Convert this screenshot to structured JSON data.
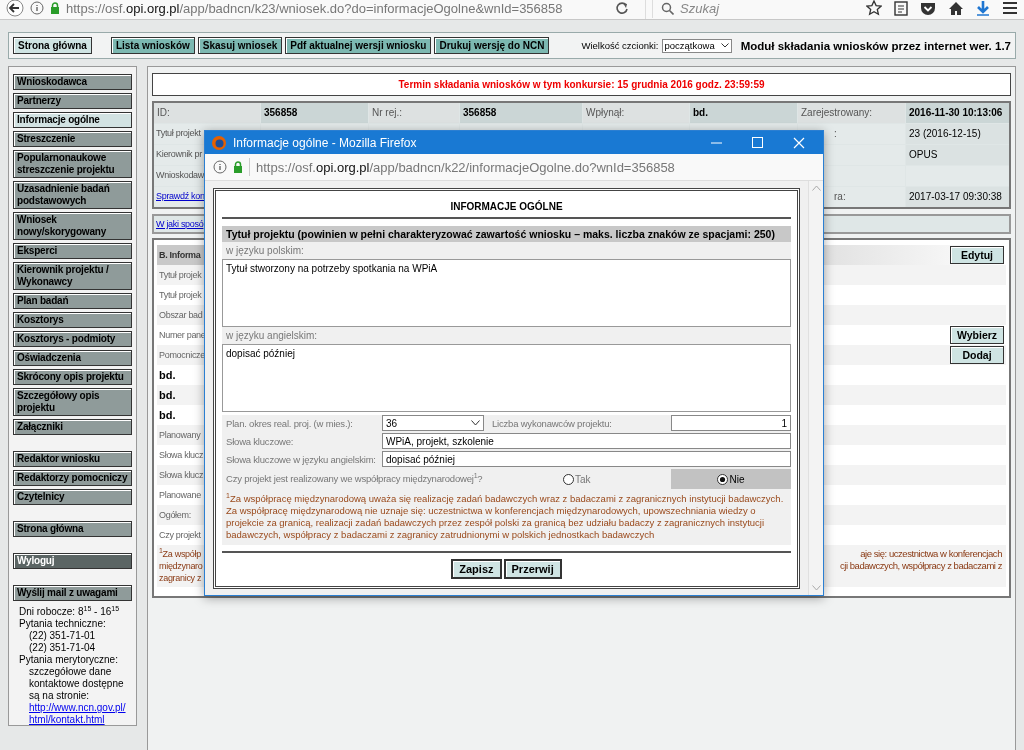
{
  "browser": {
    "url": {
      "prefix": "https://osf.",
      "domain": "opi.org.pl",
      "path": "/app/badncn/k23/wniosek.do?do=informacjeOgolne&wnId=356858"
    },
    "search": {
      "placeholder": "Szukaj"
    }
  },
  "top_nav": {
    "buttons": [
      {
        "label": "Strona główna",
        "kind": "home"
      },
      {
        "label": "Lista wniosków",
        "kind": "action"
      },
      {
        "label": "Skasuj wniosek",
        "kind": "action"
      },
      {
        "label": "Pdf aktualnej wersji wniosku",
        "kind": "action"
      },
      {
        "label": "Drukuj wersję do NCN",
        "kind": "action"
      }
    ],
    "font_size": {
      "label": "Wielkość czcionki:",
      "value": "początkowa"
    },
    "module_title": "Moduł składania wniosków przez internet wer. 1.7"
  },
  "sidebar": {
    "sections": [
      {
        "items": [
          {
            "label": "Wnioskodawca",
            "kind": "nav",
            "selected": false
          },
          {
            "label": "Partnerzy",
            "kind": "nav",
            "selected": false
          },
          {
            "label": "Informacje ogólne",
            "kind": "nav",
            "selected": true
          },
          {
            "label": "Streszczenie",
            "kind": "nav",
            "selected": false
          },
          {
            "label": "Popularnonaukowe streszczenie projektu",
            "kind": "nav",
            "selected": false
          },
          {
            "label": "Uzasadnienie badań podstawowych",
            "kind": "nav",
            "selected": false
          },
          {
            "label": "Wniosek nowy/skorygowany",
            "kind": "nav",
            "selected": false
          },
          {
            "label": "Eksperci",
            "kind": "nav",
            "selected": false
          },
          {
            "label": "Kierownik projektu / Wykonawcy",
            "kind": "nav",
            "selected": false
          },
          {
            "label": "Plan badań",
            "kind": "nav",
            "selected": false
          },
          {
            "label": "Kosztorys",
            "kind": "nav",
            "selected": false
          },
          {
            "label": "Kosztorys - podmioty",
            "kind": "nav",
            "selected": false
          },
          {
            "label": "Oświadczenia",
            "kind": "nav",
            "selected": false
          },
          {
            "label": "Skrócony opis projektu",
            "kind": "nav",
            "selected": false
          },
          {
            "label": "Szczegółowy opis projektu",
            "kind": "nav",
            "selected": false
          },
          {
            "label": "Załączniki",
            "kind": "nav",
            "selected": false
          }
        ]
      },
      {
        "items": [
          {
            "label": "Redaktor wniosku",
            "kind": "nav",
            "selected": false
          },
          {
            "label": "Redaktorzy pomocniczy",
            "kind": "nav",
            "selected": false
          },
          {
            "label": "Czytelnicy",
            "kind": "nav",
            "selected": false
          }
        ]
      },
      {
        "items": [
          {
            "label": "Strona główna",
            "kind": "nav",
            "selected": false
          }
        ]
      },
      {
        "items": [
          {
            "label": "Wyloguj",
            "kind": "logout",
            "selected": false
          }
        ]
      },
      {
        "items": [
          {
            "label": "Wyślij mail z uwagami",
            "kind": "nav",
            "selected": false
          }
        ]
      }
    ],
    "contact": {
      "hours": "Dni robocze: 8$^{15}$ - 16$^{15}$",
      "technical_label": "Pytania techniczne:",
      "phones": [
        "(22) 351-71-01",
        "(22) 351-71-04"
      ],
      "substantive_label": "Pytania merytoryczne:",
      "substantive_text": "szczegółowe dane kontaktowe dostępne są na stronie:",
      "link": "http://www.ncn.gov.pl/html/kontakt.html"
    }
  },
  "deadline": "Termin składania wniosków w tym konkursie: 15 grudnia 2016 godz. 23:59:59",
  "info_table": {
    "header_cells": [
      "ID:",
      "356858",
      "Nr rej.:",
      "356858",
      "Wpłynął:",
      "bd.",
      "Zarejestrowany:",
      "2016-11-30 10:13:06"
    ],
    "rows": [
      {
        "label": "Tytuł projekt",
        "kind": "label",
        "right_label": ":",
        "right_value": "23 (2016-12-15)"
      },
      {
        "label": "Kierownik pr",
        "kind": "label",
        "right_value": "OPUS"
      },
      {
        "label": "Wnioskodaw",
        "kind": "label"
      },
      {
        "label": "Sprawdź kon",
        "kind": "link",
        "right_label": "ra:",
        "right_value": "2017-03-17 09:30:38"
      }
    ]
  },
  "help_link": "W jaki sposó",
  "section_b": {
    "title": "B. Informa",
    "edit_button": "Edytuj",
    "rows": [
      {
        "label": "Tytuł projek",
        "kind": "label"
      },
      {
        "label": "Tytuł projek",
        "kind": "label"
      },
      {
        "label": "Obszar bad",
        "kind": "label"
      },
      {
        "label": "Numer pane",
        "kind": "label",
        "button": "Wybierz"
      },
      {
        "label": "Pomocnicze",
        "kind": "label",
        "button": "Dodaj"
      },
      {
        "label": "bd.",
        "kind": "value"
      },
      {
        "label": "bd.",
        "kind": "value"
      },
      {
        "label": "bd.",
        "kind": "value"
      },
      {
        "label": "Planowany",
        "kind": "label"
      },
      {
        "label": "Słowa klucz",
        "kind": "label"
      },
      {
        "label": "Słowa klucz",
        "kind": "label"
      },
      {
        "label": "Planowane",
        "kind": "label"
      },
      {
        "label": "Ogółem:",
        "kind": "label"
      },
      {
        "label": "Czy projekt",
        "kind": "label"
      }
    ],
    "footnote_left": [
      "$^{1}$Za współp",
      "międzynaro",
      "zagranicy z"
    ],
    "footnote_right": [
      "aje się: uczestnictwa w konferencjach",
      "cji badawczych, współpracy z badaczami z"
    ]
  },
  "popup": {
    "title": "Informacje ogólne - Mozilla Firefox",
    "url": {
      "prefix": "https://osf.",
      "domain": "opi.org.pl",
      "path": "/app/badncn/k22/informacjeOgolne.do?wnId=356858"
    },
    "heading": "INFORMACJE OGÓLNE",
    "title_section": {
      "heading": "Tytuł projektu (powinien w pełni charakteryzować zawartość wniosku – maks. liczba znaków ze spacjami: 250)",
      "polish_label": "w języku polskim:",
      "polish_value": "Tytuł stworzony na potrzeby spotkania na WPiA",
      "english_label": "w języku angielskim:",
      "english_value": "dopisać później"
    },
    "duration": {
      "label": "Plan. okres real. proj. (w mies.):",
      "value": "36"
    },
    "contractors": {
      "label": "Liczba wykonawców projektu:",
      "value": "1"
    },
    "keywords": {
      "label": "Słowa kluczowe:",
      "value": "WPiA, projekt, szkolenie"
    },
    "keywords_en": {
      "label": "Słowa kluczowe w języku angielskim:",
      "value": "dopisać później"
    },
    "cooperation": {
      "question": "Czy projekt jest realizowany we współpracy międzynarodowej$^{1}$?",
      "options": [
        {
          "label": "Tak",
          "selected": false
        },
        {
          "label": "Nie",
          "selected": true
        }
      ]
    },
    "footnote": "$^{1}$Za współpracę międzynarodową uważa się realizację zadań badawczych wraz z badaczami z zagranicznych instytucji badawczych. Za współpracę międzynarodową nie uznaje się: uczestnictwa w konferencjach międzynarodowych, upowszechniania wiedzy o projekcie za granicą, realizacji zadań badawczych przez zespół polski za granicą bez udziału badaczy z zagranicznych instytucji badawczych, współpracy z badaczami z zagranicy zatrudnionymi w polskich jednostkach badawczych",
    "buttons": [
      "Zapisz",
      "Przerwij"
    ]
  }
}
